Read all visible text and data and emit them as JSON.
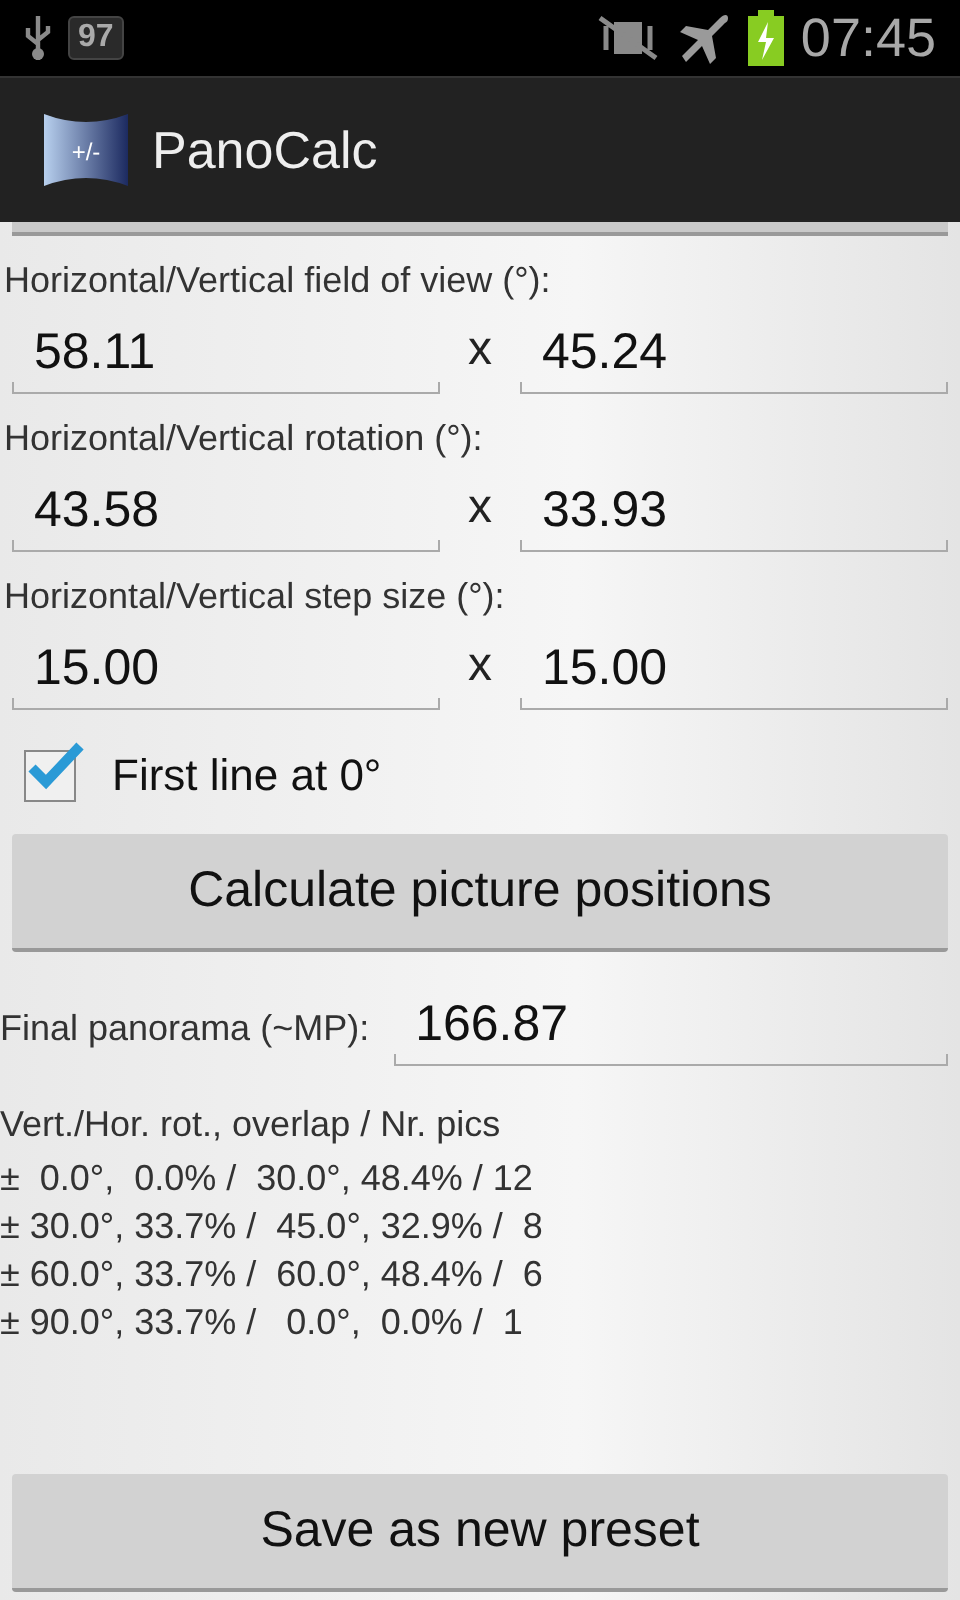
{
  "status_bar": {
    "notification_count": "97",
    "time": "07:45"
  },
  "action_bar": {
    "title": "PanoCalc",
    "icon_text": "+/-"
  },
  "field_groups": [
    {
      "label": "Horizontal/Vertical field of view (°):",
      "first": "58.11",
      "separator": "x",
      "second": "45.24"
    },
    {
      "label": "Horizontal/Vertical rotation (°):",
      "first": "43.58",
      "separator": "x",
      "second": "33.93"
    },
    {
      "label": "Horizontal/Vertical step size (°):",
      "first": "15.00",
      "separator": "x",
      "second": "15.00"
    }
  ],
  "first_line_checkbox": {
    "label": "First line at 0°",
    "checked": true
  },
  "calculate_button": "Calculate picture positions",
  "final_panorama": {
    "label": "Final panorama (~MP):",
    "value": "166.87"
  },
  "results": {
    "header": "Vert./Hor. rot., overlap / Nr. pics",
    "lines": [
      "±  0.0°,  0.0% /  30.0°, 48.4% / 12",
      "± 30.0°, 33.7% /  45.0°, 32.9% /  8",
      "± 60.0°, 33.7% /  60.0°, 48.4% /  6",
      "± 90.0°, 33.7% /   0.0°,  0.0% /  1"
    ]
  },
  "save_button": "Save as new preset"
}
